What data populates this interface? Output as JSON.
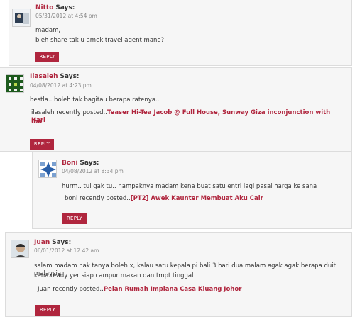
{
  "comments": [
    {
      "author": "Nitto",
      "says": "Says:",
      "date": "05/31/2012 at 4:54 pm",
      "lines": [
        "madam,",
        "bleh share tak u amek travel agent mane?"
      ],
      "reply": "REPLY"
    },
    {
      "author": "Ilasaleh",
      "says": "Says:",
      "date": "04/08/2012 at 4:23 pm",
      "lines": [
        "bestla.. boleh tak bagitau berapa ratenya.."
      ],
      "recent_prefix": "ilasaleh recently posted..",
      "recent_post_1": "Teaser Hi-Tea Jacob @ Full House, Sunway Giza inconjunction with Hari",
      "recent_post_2": "Ibu",
      "reply": "REPLY"
    },
    {
      "author": "Boni",
      "says": "Says:",
      "date": "04/08/2012 at 8:34 pm",
      "lines": [
        "hurm.. tul gak tu.. nampaknya madam kena buat satu entri lagi pasal harga ke sana"
      ],
      "recent_prefix": "boni recently posted..",
      "recent_post": "[PT2] Awek Kaunter Membuat Aku Cair",
      "reply": "REPLY"
    },
    {
      "author": "Juan",
      "says": "Says:",
      "date": "06/01/2012 at 12:42 am",
      "lines": [
        "salam madam nak tanya boleh x, kalau satu kepala pi bali 3 hari dua malam agak agak berapa duit malaysia",
        "kena ready yer siap campur makan dan tmpt tinggal"
      ],
      "recent_prefix": "Juan recently posted..",
      "recent_post": "Pelan Rumah Impiana Casa Kluang Johor",
      "reply": "REPLY"
    }
  ],
  "colors": {
    "accent": "#b0263e",
    "box_bg": "#f6f6f6",
    "border": "#dcdcdc"
  }
}
